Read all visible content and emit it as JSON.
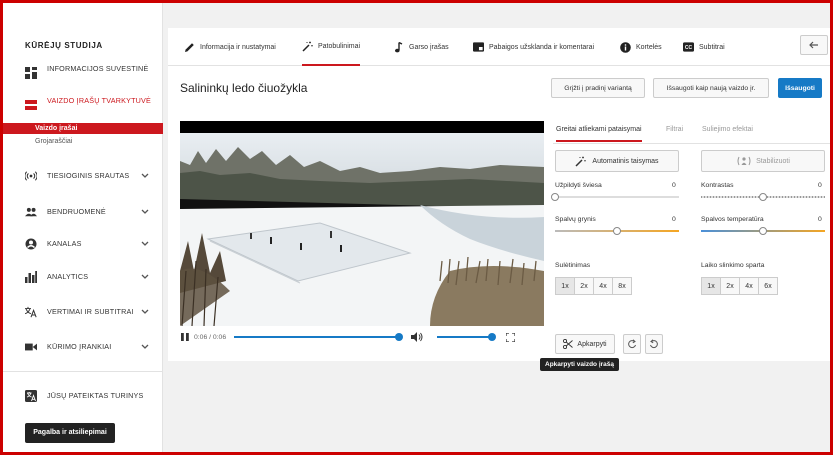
{
  "sidebar": {
    "title": "KŪRĖJŲ STUDIJA",
    "items": [
      {
        "label": "INFORMACIJOS SUVESTINĖ"
      },
      {
        "label": "VAIZDO ĮRAŠŲ TVARKYTUVĖ"
      },
      {
        "label": "TIESIOGINIS SRAUTAS"
      },
      {
        "label": "BENDRUOMENĖ"
      },
      {
        "label": "KANALAS"
      },
      {
        "label": "ANALYTICS"
      },
      {
        "label": "VERTIMAI IR SUBTITRAI"
      },
      {
        "label": "KŪRIMO ĮRANKIAI"
      },
      {
        "label": "JŪSŲ PATEIKTAS TURINYS"
      }
    ],
    "subitems": [
      "Vaizdo įrašai",
      "Grojaraščiai"
    ],
    "help": "Pagalba ir atsiliepimai"
  },
  "tabs": [
    {
      "label": "Informacija ir nustatymai"
    },
    {
      "label": "Patobulinimai"
    },
    {
      "label": "Garso įrašas"
    },
    {
      "label": "Pabaigos užsklanda ir komentarai"
    },
    {
      "label": "Kortelės"
    },
    {
      "label": "Subtitrai"
    }
  ],
  "video": {
    "title": "Salininkų ledo čiuožykla",
    "time": "0:06 / 0:06",
    "progress": 1.0,
    "volume": 1.0
  },
  "actions": {
    "revert": "Grįžti į pradinį variantą",
    "save_new": "Išsaugoti kaip naują vaizdo įr.",
    "save": "Išsaugoti"
  },
  "subtabs": [
    "Greitai atliekami pataisymai",
    "Filtrai",
    "Suliejimo efektai"
  ],
  "quick": {
    "auto_fix": "Automatinis taisymas",
    "stabilize": "Stabilizuoti",
    "fill_light": {
      "label": "Užpildyti šviesa",
      "value": "0",
      "level": 0
    },
    "contrast": {
      "label": "Kontrastas",
      "value": "0",
      "level": 0.5
    },
    "saturation": {
      "label": "Spalvų grynis",
      "value": "0",
      "level": 0.5
    },
    "temperature": {
      "label": "Spalvos temperatūra",
      "value": "0",
      "level": 0.5
    },
    "slowmo": {
      "label": "Sulėtinimas",
      "options": [
        "1x",
        "2x",
        "4x",
        "8x"
      ]
    },
    "timelapse": {
      "label": "Laiko slinkimo sparta",
      "options": [
        "1x",
        "2x",
        "4x",
        "6x"
      ]
    },
    "trim": "Apkarpyti",
    "tooltip": "Apkarpyti vaizdo įrašą"
  },
  "colors": {
    "accent": "#cc181e",
    "primary": "#167ac6"
  }
}
